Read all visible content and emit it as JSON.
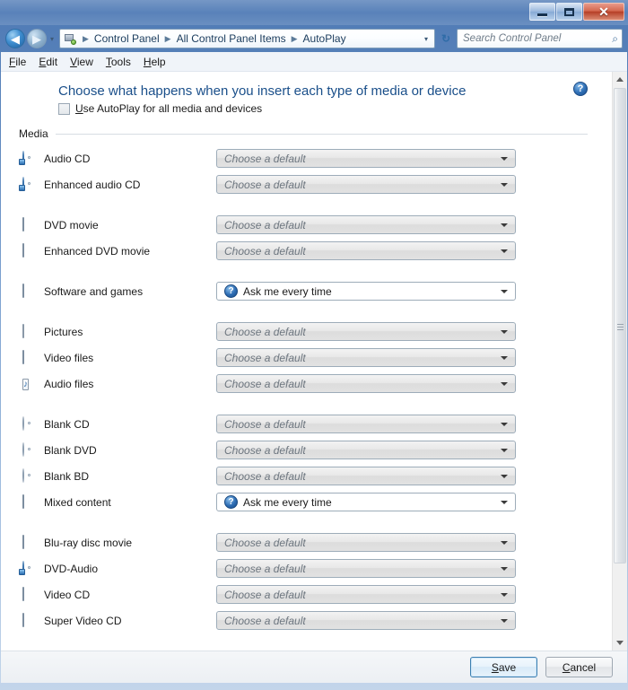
{
  "window": {
    "buttons": {
      "minimize": "minimize",
      "maximize": "maximize",
      "close": "✕"
    }
  },
  "nav": {
    "back": "◀",
    "forward": "▶",
    "history_dropdown": "▾",
    "address_dropdown": "▾",
    "refresh": "↻",
    "breadcrumbs": [
      "Control Panel",
      "All Control Panel Items",
      "AutoPlay"
    ],
    "separator": "▶"
  },
  "search": {
    "placeholder": "Search Control Panel",
    "icon": "⌕"
  },
  "menubar": {
    "items": [
      {
        "accel": "F",
        "rest": "ile"
      },
      {
        "accel": "E",
        "rest": "dit"
      },
      {
        "accel": "V",
        "rest": "iew"
      },
      {
        "accel": "T",
        "rest": "ools"
      },
      {
        "accel": "H",
        "rest": "elp"
      }
    ]
  },
  "main": {
    "title": "Choose what happens when you insert each type of media or device",
    "help_icon": "?",
    "use_autoplay": {
      "accel": "U",
      "rest": "se AutoPlay for all media and devices",
      "checked": false
    },
    "group_label": "Media",
    "combo_placeholder": "Choose a default",
    "combo_ask": "Ask me every time",
    "rows": [
      {
        "label": "Audio CD",
        "icon": "audio-cd-icon",
        "value": "Choose a default",
        "active": false,
        "gap": false
      },
      {
        "label": "Enhanced audio CD",
        "icon": "enhanced-audio-cd-icon",
        "value": "Choose a default",
        "active": false,
        "gap": false
      },
      {
        "label": "DVD movie",
        "icon": "dvd-movie-icon",
        "value": "Choose a default",
        "active": false,
        "gap": true
      },
      {
        "label": "Enhanced DVD movie",
        "icon": "enhanced-dvd-movie-icon",
        "value": "Choose a default",
        "active": false,
        "gap": false
      },
      {
        "label": "Software and games",
        "icon": "software-games-icon",
        "value": "Ask me every time",
        "active": true,
        "gap": true
      },
      {
        "label": "Pictures",
        "icon": "pictures-icon",
        "value": "Choose a default",
        "active": false,
        "gap": true
      },
      {
        "label": "Video files",
        "icon": "video-files-icon",
        "value": "Choose a default",
        "active": false,
        "gap": false
      },
      {
        "label": "Audio files",
        "icon": "audio-files-icon",
        "value": "Choose a default",
        "active": false,
        "gap": false
      },
      {
        "label": "Blank CD",
        "icon": "blank-cd-icon",
        "value": "Choose a default",
        "active": false,
        "gap": true
      },
      {
        "label": "Blank DVD",
        "icon": "blank-dvd-icon",
        "value": "Choose a default",
        "active": false,
        "gap": false
      },
      {
        "label": "Blank BD",
        "icon": "blank-bd-icon",
        "value": "Choose a default",
        "active": false,
        "gap": false
      },
      {
        "label": "Mixed content",
        "icon": "mixed-content-icon",
        "value": "Ask me every time",
        "active": true,
        "gap": false
      },
      {
        "label": "Blu-ray disc movie",
        "icon": "bluray-disc-movie-icon",
        "value": "Choose a default",
        "active": false,
        "gap": true
      },
      {
        "label": "DVD-Audio",
        "icon": "dvd-audio-icon",
        "value": "Choose a default",
        "active": false,
        "gap": false
      },
      {
        "label": "Video CD",
        "icon": "video-cd-icon",
        "value": "Choose a default",
        "active": false,
        "gap": false
      },
      {
        "label": "Super Video CD",
        "icon": "super-video-cd-icon",
        "value": "Choose a default",
        "active": false,
        "gap": false
      }
    ]
  },
  "footer": {
    "save": {
      "accel": "S",
      "rest": "ave"
    },
    "cancel": {
      "accel": "C",
      "rest": "ancel"
    }
  }
}
